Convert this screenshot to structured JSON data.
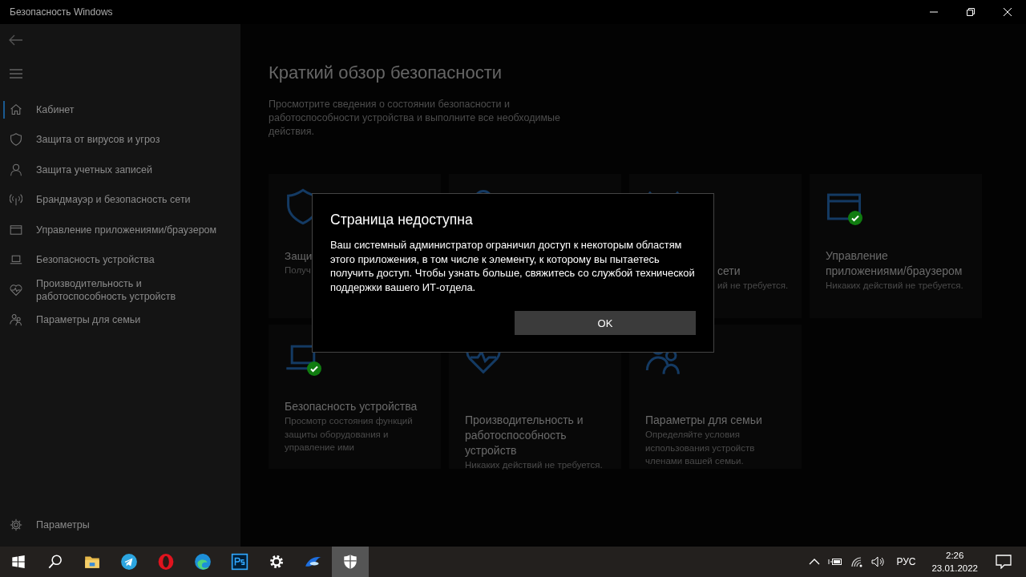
{
  "window": {
    "title": "Безопасность Windows"
  },
  "sidebar": {
    "items": [
      {
        "kind": "home",
        "label": "Кабинет",
        "selected": true
      },
      {
        "kind": "shield",
        "label": "Защита от вирусов и угроз",
        "selected": false
      },
      {
        "kind": "person",
        "label": "Защита учетных записей",
        "selected": false
      },
      {
        "kind": "antenna",
        "label": "Брандмауэр и безопасность сети",
        "selected": false
      },
      {
        "kind": "browser",
        "label": "Управление приложениями/браузером",
        "selected": false
      },
      {
        "kind": "laptop",
        "label": "Безопасность устройства",
        "selected": false
      },
      {
        "kind": "heart",
        "label": "Производительность и работоспособность устройств",
        "selected": false
      },
      {
        "kind": "family",
        "label": "Параметры для семьи",
        "selected": false
      }
    ],
    "settings": {
      "label": "Параметры"
    }
  },
  "page": {
    "title": "Краткий обзор безопасности",
    "description": "Просмотрите сведения о состоянии безопасности и работоспособности устройства и выполните все необходимые действия."
  },
  "cards": [
    {
      "kind": "shield",
      "title": "Защи",
      "description": "Получ",
      "check": false
    },
    {
      "kind": "person",
      "check": false
    },
    {
      "kind": "antenna",
      "title": "сети",
      "description": "ий не требуется.",
      "check": false
    },
    {
      "kind": "browser",
      "title": "Управление приложениями/браузером",
      "description": "Никаких действий не требуется.",
      "check": true
    },
    {
      "kind": "laptop",
      "title": "Безопасность устройства",
      "description": "Просмотр состояния функций защиты оборудования и управление ими",
      "check": true
    },
    {
      "kind": "heart",
      "title": "Производительность и работоспособность устройств",
      "description": "Никаких действий не требуется.",
      "check": false
    },
    {
      "kind": "family",
      "title": "Параметры для семьи",
      "description": "Определяйте условия использования устройств членами вашей семьи.",
      "check": false
    }
  ],
  "dialog": {
    "title": "Страница недоступна",
    "message": "Ваш системный администратор ограничил доступ к некоторым областям этого приложения, в том числе к элементу, к которому вы пытаетесь получить доступ. Чтобы узнать больше, свяжитесь со службой технической поддержки вашего ИТ-отдела.",
    "button": "OK"
  },
  "taskbar": {
    "apps": [
      {
        "kind": "start",
        "selected": false
      },
      {
        "kind": "search",
        "selected": false
      },
      {
        "kind": "folder",
        "selected": false
      },
      {
        "kind": "telegram",
        "selected": false
      },
      {
        "kind": "opera",
        "selected": false
      },
      {
        "kind": "edge",
        "selected": false
      },
      {
        "kind": "ps",
        "selected": false
      },
      {
        "kind": "gear",
        "selected": false
      },
      {
        "kind": "swoosh",
        "selected": false
      },
      {
        "kind": "defender",
        "selected": true
      }
    ],
    "language": "РУС",
    "time": "2:26",
    "date": "23.01.2022"
  }
}
